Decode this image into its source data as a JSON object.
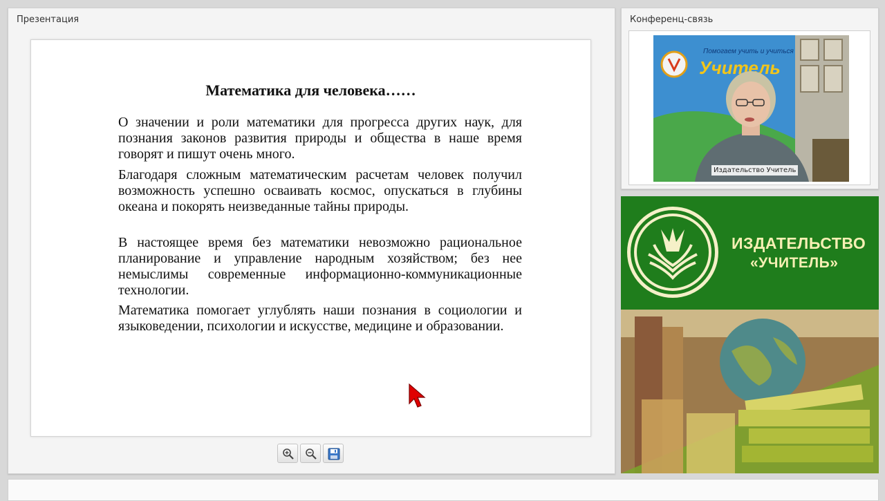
{
  "presentation_panel": {
    "title": "Презентация"
  },
  "slide": {
    "title": "Математика для человека……",
    "paragraphs": [
      "О значении и роли математики для прогресса других наук, для познания законов развития природы и общества в наше время говорят и пишут очень много.",
      "Благодаря сложным математическим расчетам человек получил возможность успешно осваивать космос, опускаться в глубины океана и покорять неизведанные тайны природы.",
      "В настоящее время без математики невозможно рациональное планирование и управление народным хозяйством; без нее немыслимы современные информационно-коммуникационные технологии.",
      "Математика помогает углублять наши познания в социологии и языковедении, психологии и искусстве, медицине и образовании."
    ]
  },
  "toolbar": {
    "zoom_in_icon": "zoom-in-icon",
    "zoom_out_icon": "zoom-out-icon",
    "save_icon": "floppy-disk-icon"
  },
  "conference_panel": {
    "title": "Конференц-связь",
    "video_label": "Издательство Учитель",
    "backdrop_text": "Помогаем учить и учиться",
    "backdrop_brand": "Учитель"
  },
  "banner": {
    "line1": "ИЗДАТЕЛЬСТВО",
    "line2": "«УЧИТЕЛЬ»",
    "brand_color": "#1f7d1c",
    "text_color": "#f7f0b4"
  },
  "colors": {
    "background": "#d8d8d8",
    "cursor": "#e00000"
  }
}
